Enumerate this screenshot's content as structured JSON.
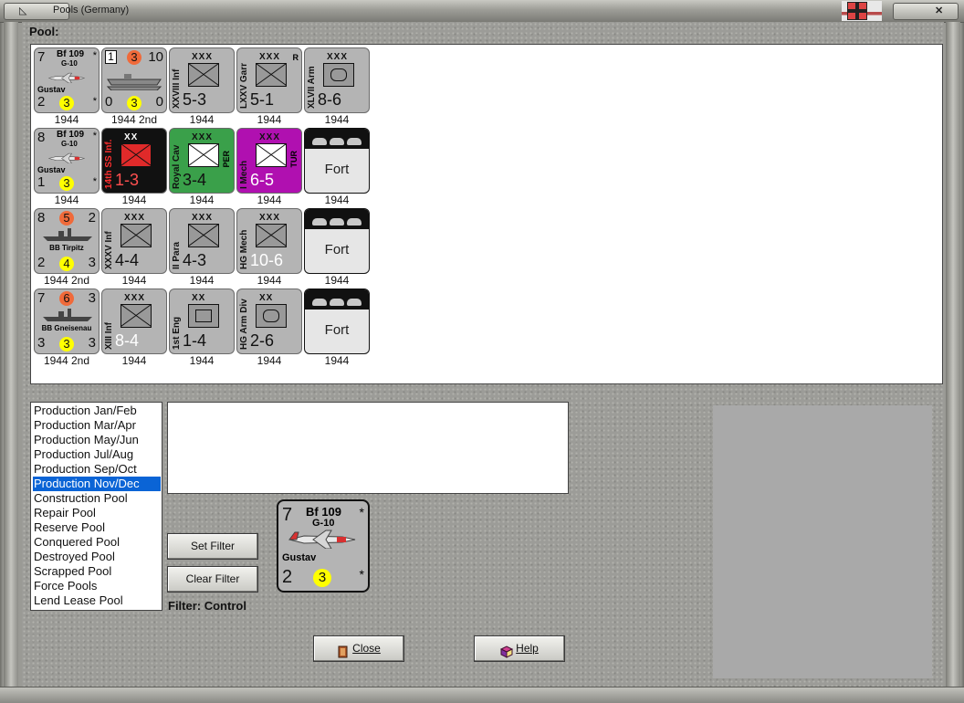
{
  "window": {
    "title": "Pools (Germany)"
  },
  "pool": {
    "label": "Pool:",
    "counters": [
      [
        {
          "kind": "air",
          "name": "Bf 109",
          "variant": "G-10",
          "pilot": "Gustav",
          "tl": "7",
          "bl": "2",
          "mid": "3",
          "star_top": "*",
          "star_bot": "*",
          "caption": "1944"
        },
        {
          "kind": "naval",
          "tl": "1",
          "tm": "3",
          "tr": "10",
          "bl": "0",
          "bm": "3",
          "br": "0",
          "caption": "1944 2nd"
        },
        {
          "kind": "land",
          "label": "XXVIII Inf",
          "size": "XXX",
          "strength": "5-3",
          "caption": "1944"
        },
        {
          "kind": "land",
          "label": "LXXV Garr",
          "size": "XXX",
          "extra": "R",
          "strength": "5-1",
          "caption": "1944"
        },
        {
          "kind": "land",
          "label": "XLVII Arm",
          "size": "XXX",
          "strength": "8-6",
          "caption": "1944"
        }
      ],
      [
        {
          "kind": "air",
          "name": "Bf 109",
          "variant": "G-10",
          "pilot": "Gustav",
          "tl": "8",
          "bl": "1",
          "mid": "3",
          "star_top": "*",
          "star_bot": "*",
          "caption": "1944"
        },
        {
          "kind": "land-black",
          "label": "14th SS Inf.",
          "size": "XX",
          "strength": "1-3",
          "caption": "1944"
        },
        {
          "kind": "land-green",
          "label": "Royal Cav",
          "size": "XXX",
          "extra": "PER",
          "strength": "3-4",
          "caption": "1944"
        },
        {
          "kind": "land-magenta",
          "label": "I Mech",
          "size": "XXX",
          "extra": "TUR",
          "strength": "6-5",
          "caption": "1944"
        },
        {
          "kind": "fort",
          "text": "Fort",
          "caption": "1944"
        }
      ],
      [
        {
          "kind": "ship",
          "tl": "8",
          "tm": "5",
          "tr": "2",
          "name": "BB Tirpitz",
          "bl": "2",
          "bm": "4",
          "br": "3",
          "caption": "1944 2nd"
        },
        {
          "kind": "land",
          "label": "XXXV Inf",
          "size": "XXX",
          "strength": "4-4",
          "caption": "1944"
        },
        {
          "kind": "land",
          "label": "II Para",
          "size": "XXX",
          "strength": "4-3",
          "caption": "1944"
        },
        {
          "kind": "land",
          "label": "HG Mech",
          "size": "XXX",
          "strength": "10-6",
          "caption": "1944"
        },
        {
          "kind": "fort",
          "text": "Fort",
          "caption": "1944"
        }
      ],
      [
        {
          "kind": "ship",
          "tl": "7",
          "tm": "6",
          "tr": "3",
          "name": "BB Gneisenau",
          "bl": "3",
          "bm": "3",
          "br": "3",
          "caption": "1944 2nd"
        },
        {
          "kind": "land",
          "label": "XIII Inf",
          "size": "XXX",
          "strength": "8-4",
          "caption": "1944"
        },
        {
          "kind": "land",
          "label": "1st Eng",
          "size": "XX",
          "strength": "1-4",
          "caption": "1944"
        },
        {
          "kind": "land",
          "label": "HG Arm Div",
          "size": "XX",
          "strength": "2-6",
          "caption": "1944"
        },
        {
          "kind": "fort",
          "text": "Fort",
          "caption": "1944"
        }
      ]
    ]
  },
  "pool_list": {
    "items": [
      "Production Jan/Feb",
      "Production Mar/Apr",
      "Production May/Jun",
      "Production Jul/Aug",
      "Production Sep/Oct",
      "Production Nov/Dec",
      "Construction Pool",
      "Repair Pool",
      "Reserve Pool",
      "Conquered Pool",
      "Destroyed Pool",
      "Scrapped Pool",
      "Force Pools",
      "Lend Lease Pool"
    ],
    "selected": "Production Nov/Dec"
  },
  "buttons": {
    "set_filter": "Set Filter",
    "clear_filter": "Clear Filter",
    "close": "Close",
    "help": "Help"
  },
  "filter": {
    "label": "Filter: Control"
  },
  "selected_counter": {
    "name": "Bf 109",
    "variant": "G-10",
    "pilot": "Gustav",
    "tl": "7",
    "bl": "2",
    "mid": "3",
    "star_top": "*",
    "star_bot": "*"
  },
  "colors": {
    "selection": "#0a64d6",
    "black_unit": "#111111",
    "green_unit": "#3aa04a",
    "magenta_unit": "#b010b0",
    "red_unit": "#e02a2a",
    "yellow_circle": "#ffff00",
    "orange_circle": "#f06a3a"
  }
}
